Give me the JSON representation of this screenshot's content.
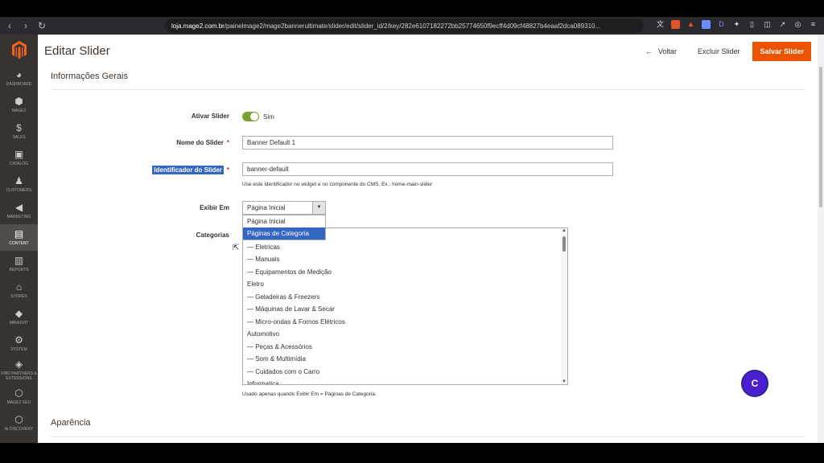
{
  "browser": {
    "url_host": "loja.mage2.com.br",
    "url_path": "/painelmage2/mage2bannerultimate/slider/edit/slider_id/2/key/282e6107182272bb25774650f9ecff4d09cf48827b4eaaf2dca089310..."
  },
  "sidebar": {
    "items": [
      {
        "label": "DASHBOARD",
        "icon": "dashboard-icon",
        "glyph": "◕"
      },
      {
        "label": "MAGE2",
        "icon": "hexagon-icon",
        "glyph": "⬢"
      },
      {
        "label": "SALES",
        "icon": "dollar-icon",
        "glyph": "$"
      },
      {
        "label": "CATALOG",
        "icon": "box-icon",
        "glyph": "▣"
      },
      {
        "label": "CUSTOMERS",
        "icon": "person-icon",
        "glyph": "♟"
      },
      {
        "label": "MARKETING",
        "icon": "megaphone-icon",
        "glyph": "◀"
      },
      {
        "label": "CONTENT",
        "icon": "content-icon",
        "glyph": "▤"
      },
      {
        "label": "REPORTS",
        "icon": "bar-chart-icon",
        "glyph": "▥"
      },
      {
        "label": "STORES",
        "icon": "store-icon",
        "glyph": "⌂"
      },
      {
        "label": "MIRASVIT",
        "icon": "diamond-icon",
        "glyph": "◆"
      },
      {
        "label": "SYSTEM",
        "icon": "gear-icon",
        "glyph": "⚙"
      },
      {
        "label": "FIND PARTNERS & EXTENSIONS",
        "icon": "extensions-icon",
        "glyph": "◈"
      },
      {
        "label": "MAGE2 SEO",
        "icon": "hexagon-outline-icon",
        "glyph": "⬡"
      },
      {
        "label": "AI DISCOVERY",
        "icon": "ai-icon",
        "glyph": "⬡"
      }
    ],
    "active": "CONTENT"
  },
  "header": {
    "title": "Editar Slider",
    "back_label": "Voltar",
    "delete_label": "Excluir Slider",
    "save_label": "Salvar Slider"
  },
  "general": {
    "section_title": "Informações Gerais",
    "ativar_label": "Ativar Slider",
    "ativar_value": "Sim",
    "nome_label": "Nome do Slider",
    "nome_value": "Banner Default 1",
    "identificador_label": "Identificador do Slider",
    "identificador_value": "banner-default",
    "identificador_note": "Use este identificador no widget e no componente do CMS. Ex.: home-main-slider",
    "exibir_label": "Exibir Em",
    "exibir_value": "Página Inicial",
    "exibir_options": [
      "Página Inicial",
      "Páginas de Categoria"
    ],
    "categorias_label": "Categorias",
    "categorias": [
      "",
      "— Eletricas",
      "— Manuais",
      "— Equipamentos de Medição",
      "Eletro",
      "— Geladeiras & Freezers",
      "— Máquinas de Lavar & Secar",
      "— Micro-ondas & Fornos Elétricos",
      "Automotivo",
      "— Peças & Acessórios",
      "— Som & Multimídia",
      "— Cuidados com o Carro",
      "Informatica"
    ],
    "categorias_note": "Usado apenas quando Exibir Em = Páginas de Categoria."
  },
  "appearance": {
    "section_title": "Aparência"
  },
  "chat": {
    "label": "C"
  }
}
